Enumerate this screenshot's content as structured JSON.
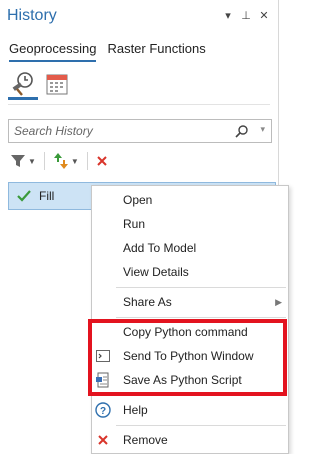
{
  "header": {
    "title": "History"
  },
  "title_tools": {
    "dropdown": "▾",
    "pin": "⊥",
    "close": "✕"
  },
  "tabs": [
    {
      "label": "Geoprocessing",
      "active": true
    },
    {
      "label": "Raster Functions",
      "active": false
    }
  ],
  "search": {
    "placeholder": "Search History",
    "value": ""
  },
  "history": {
    "items": [
      {
        "label": "Fill",
        "status": "success"
      }
    ]
  },
  "context_menu": {
    "items": {
      "open": "Open",
      "run": "Run",
      "add_to_model": "Add To Model",
      "view_details": "View Details",
      "share_as": "Share As",
      "copy_python": "Copy Python command",
      "send_to_python": "Send To Python Window",
      "save_as_script": "Save As Python Script",
      "help": "Help",
      "remove": "Remove"
    }
  },
  "colors": {
    "accent": "#2e6fad",
    "selection": "#cde3f5",
    "highlight_box": "#e3131f",
    "success": "#3a9a3a",
    "remove": "#d9352b"
  }
}
